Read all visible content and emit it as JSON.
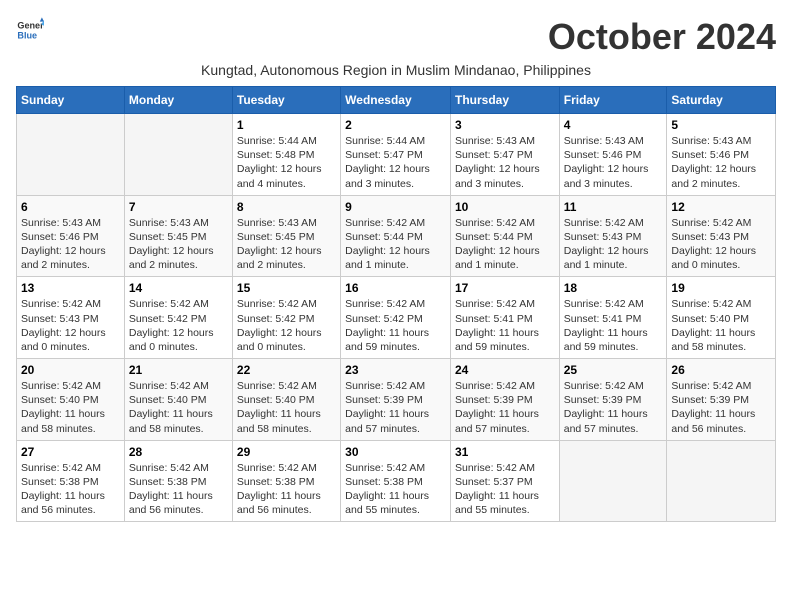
{
  "logo": {
    "general": "General",
    "blue": "Blue"
  },
  "header": {
    "title": "October 2024",
    "subtitle": "Kungtad, Autonomous Region in Muslim Mindanao, Philippines"
  },
  "weekdays": [
    "Sunday",
    "Monday",
    "Tuesday",
    "Wednesday",
    "Thursday",
    "Friday",
    "Saturday"
  ],
  "weeks": [
    [
      {
        "day": "",
        "info": ""
      },
      {
        "day": "",
        "info": ""
      },
      {
        "day": "1",
        "info": "Sunrise: 5:44 AM\nSunset: 5:48 PM\nDaylight: 12 hours and 4 minutes."
      },
      {
        "day": "2",
        "info": "Sunrise: 5:44 AM\nSunset: 5:47 PM\nDaylight: 12 hours and 3 minutes."
      },
      {
        "day": "3",
        "info": "Sunrise: 5:43 AM\nSunset: 5:47 PM\nDaylight: 12 hours and 3 minutes."
      },
      {
        "day": "4",
        "info": "Sunrise: 5:43 AM\nSunset: 5:46 PM\nDaylight: 12 hours and 3 minutes."
      },
      {
        "day": "5",
        "info": "Sunrise: 5:43 AM\nSunset: 5:46 PM\nDaylight: 12 hours and 2 minutes."
      }
    ],
    [
      {
        "day": "6",
        "info": "Sunrise: 5:43 AM\nSunset: 5:46 PM\nDaylight: 12 hours and 2 minutes."
      },
      {
        "day": "7",
        "info": "Sunrise: 5:43 AM\nSunset: 5:45 PM\nDaylight: 12 hours and 2 minutes."
      },
      {
        "day": "8",
        "info": "Sunrise: 5:43 AM\nSunset: 5:45 PM\nDaylight: 12 hours and 2 minutes."
      },
      {
        "day": "9",
        "info": "Sunrise: 5:42 AM\nSunset: 5:44 PM\nDaylight: 12 hours and 1 minute."
      },
      {
        "day": "10",
        "info": "Sunrise: 5:42 AM\nSunset: 5:44 PM\nDaylight: 12 hours and 1 minute."
      },
      {
        "day": "11",
        "info": "Sunrise: 5:42 AM\nSunset: 5:43 PM\nDaylight: 12 hours and 1 minute."
      },
      {
        "day": "12",
        "info": "Sunrise: 5:42 AM\nSunset: 5:43 PM\nDaylight: 12 hours and 0 minutes."
      }
    ],
    [
      {
        "day": "13",
        "info": "Sunrise: 5:42 AM\nSunset: 5:43 PM\nDaylight: 12 hours and 0 minutes."
      },
      {
        "day": "14",
        "info": "Sunrise: 5:42 AM\nSunset: 5:42 PM\nDaylight: 12 hours and 0 minutes."
      },
      {
        "day": "15",
        "info": "Sunrise: 5:42 AM\nSunset: 5:42 PM\nDaylight: 12 hours and 0 minutes."
      },
      {
        "day": "16",
        "info": "Sunrise: 5:42 AM\nSunset: 5:42 PM\nDaylight: 11 hours and 59 minutes."
      },
      {
        "day": "17",
        "info": "Sunrise: 5:42 AM\nSunset: 5:41 PM\nDaylight: 11 hours and 59 minutes."
      },
      {
        "day": "18",
        "info": "Sunrise: 5:42 AM\nSunset: 5:41 PM\nDaylight: 11 hours and 59 minutes."
      },
      {
        "day": "19",
        "info": "Sunrise: 5:42 AM\nSunset: 5:40 PM\nDaylight: 11 hours and 58 minutes."
      }
    ],
    [
      {
        "day": "20",
        "info": "Sunrise: 5:42 AM\nSunset: 5:40 PM\nDaylight: 11 hours and 58 minutes."
      },
      {
        "day": "21",
        "info": "Sunrise: 5:42 AM\nSunset: 5:40 PM\nDaylight: 11 hours and 58 minutes."
      },
      {
        "day": "22",
        "info": "Sunrise: 5:42 AM\nSunset: 5:40 PM\nDaylight: 11 hours and 58 minutes."
      },
      {
        "day": "23",
        "info": "Sunrise: 5:42 AM\nSunset: 5:39 PM\nDaylight: 11 hours and 57 minutes."
      },
      {
        "day": "24",
        "info": "Sunrise: 5:42 AM\nSunset: 5:39 PM\nDaylight: 11 hours and 57 minutes."
      },
      {
        "day": "25",
        "info": "Sunrise: 5:42 AM\nSunset: 5:39 PM\nDaylight: 11 hours and 57 minutes."
      },
      {
        "day": "26",
        "info": "Sunrise: 5:42 AM\nSunset: 5:39 PM\nDaylight: 11 hours and 56 minutes."
      }
    ],
    [
      {
        "day": "27",
        "info": "Sunrise: 5:42 AM\nSunset: 5:38 PM\nDaylight: 11 hours and 56 minutes."
      },
      {
        "day": "28",
        "info": "Sunrise: 5:42 AM\nSunset: 5:38 PM\nDaylight: 11 hours and 56 minutes."
      },
      {
        "day": "29",
        "info": "Sunrise: 5:42 AM\nSunset: 5:38 PM\nDaylight: 11 hours and 56 minutes."
      },
      {
        "day": "30",
        "info": "Sunrise: 5:42 AM\nSunset: 5:38 PM\nDaylight: 11 hours and 55 minutes."
      },
      {
        "day": "31",
        "info": "Sunrise: 5:42 AM\nSunset: 5:37 PM\nDaylight: 11 hours and 55 minutes."
      },
      {
        "day": "",
        "info": ""
      },
      {
        "day": "",
        "info": ""
      }
    ]
  ]
}
